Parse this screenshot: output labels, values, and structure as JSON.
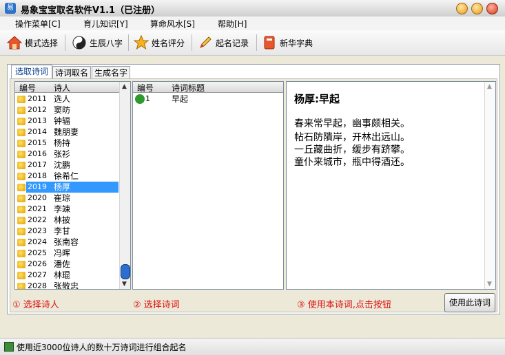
{
  "window": {
    "title": "易象宝宝取名软件V1.1（已注册）"
  },
  "menu": [
    {
      "label": "操作菜单[C]"
    },
    {
      "label": "育儿知识[Y]"
    },
    {
      "label": "算命风水[S]"
    },
    {
      "label": "帮助[H]"
    }
  ],
  "toolbar": [
    {
      "label": "模式选择",
      "icon": "house-icon"
    },
    {
      "label": "生辰八字",
      "icon": "yin-yang-icon"
    },
    {
      "label": "姓名评分",
      "icon": "star-icon"
    },
    {
      "label": "起名记录",
      "icon": "pencil-icon"
    },
    {
      "label": "新华字典",
      "icon": "book-icon"
    }
  ],
  "tabs": [
    {
      "label": "选取诗词",
      "active": true
    },
    {
      "label": "诗词取名",
      "active": false
    },
    {
      "label": "生成名字",
      "active": false
    }
  ],
  "poets": {
    "headers": [
      "编号",
      "诗人"
    ],
    "rows": [
      {
        "num": "2011",
        "name": "选人"
      },
      {
        "num": "2012",
        "name": "窦昉"
      },
      {
        "num": "2013",
        "name": "钟辐"
      },
      {
        "num": "2014",
        "name": "魏朋妻"
      },
      {
        "num": "2015",
        "name": "杨持"
      },
      {
        "num": "2016",
        "name": "张衫"
      },
      {
        "num": "2017",
        "name": "沈鹏"
      },
      {
        "num": "2018",
        "name": "徐希仁"
      },
      {
        "num": "2019",
        "name": "杨厚"
      },
      {
        "num": "2020",
        "name": "崔琮"
      },
      {
        "num": "2021",
        "name": "李竦"
      },
      {
        "num": "2022",
        "name": "林披"
      },
      {
        "num": "2023",
        "name": "李甘"
      },
      {
        "num": "2024",
        "name": "张南容"
      },
      {
        "num": "2025",
        "name": "冯晖"
      },
      {
        "num": "2026",
        "name": "潘佐"
      },
      {
        "num": "2027",
        "name": "林琨"
      },
      {
        "num": "2028",
        "name": "张敬忠"
      }
    ],
    "selected_index": 8
  },
  "poems": {
    "headers": [
      "编号",
      "诗词标题"
    ],
    "rows": [
      {
        "num": "1",
        "title": "早起"
      }
    ]
  },
  "poem": {
    "title": "杨厚:早起",
    "lines": [
      "春来常早起，幽事颇相关。",
      "帖石防隤岸，开林出远山。",
      "一丘藏曲折，缓步有跻攀。",
      "童仆来城市，瓶中得酒还。"
    ]
  },
  "steps": [
    "① 选择诗人",
    "② 选择诗词",
    "③ 使用本诗词,点击按钮"
  ],
  "use_button": "使用此诗词",
  "status": "使用近3000位诗人的数十万诗词进行组合起名",
  "colors": {
    "selection": "#3399ff",
    "step_text": "#dd1111"
  }
}
